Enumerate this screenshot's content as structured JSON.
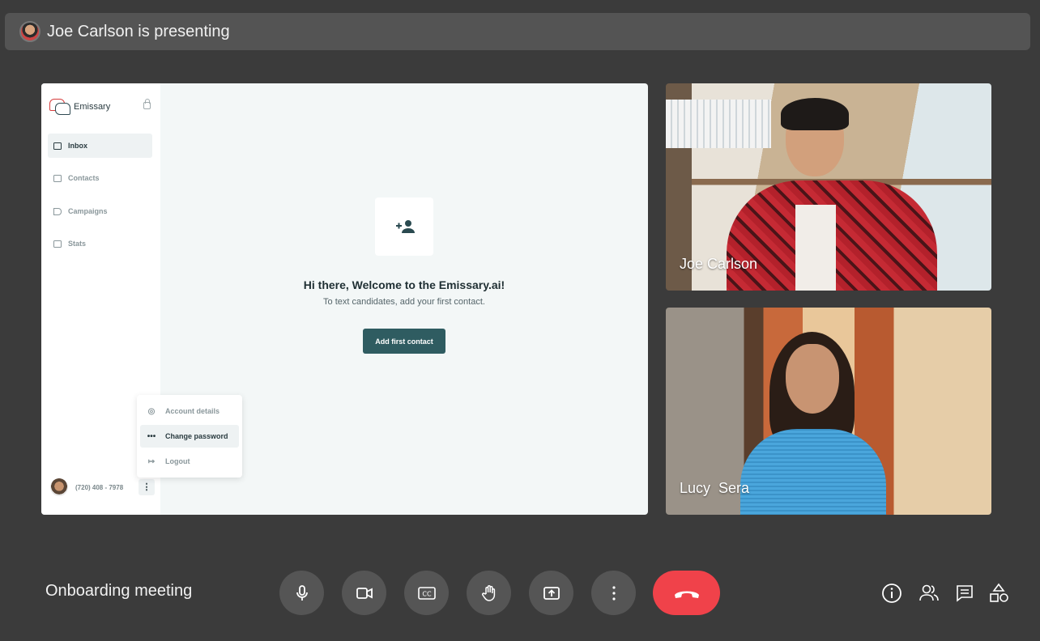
{
  "presenter_bar": {
    "text": "Joe Carlson is presenting"
  },
  "shared_screen": {
    "brand_name": "Emissary",
    "nav": [
      {
        "label": "Inbox",
        "icon": "inbox-icon",
        "active": true
      },
      {
        "label": "Contacts",
        "icon": "contacts-icon",
        "active": false
      },
      {
        "label": "Campaigns",
        "icon": "megaphone-icon",
        "active": false
      },
      {
        "label": "Stats",
        "icon": "stats-icon",
        "active": false
      }
    ],
    "popup_menu": [
      {
        "label": "Account details",
        "icon": "account-icon"
      },
      {
        "label": "Change password",
        "icon": "password-icon",
        "active": true
      },
      {
        "label": "Logout",
        "icon": "logout-icon"
      }
    ],
    "user_phone": "(720) 408 - 7978",
    "welcome_title": "Hi there, Welcome to the Emissary.ai!",
    "welcome_subtitle": "To text candidates, add your first contact.",
    "add_contact_label": "Add first contact",
    "accent_color": "#2f5c61"
  },
  "participants": [
    {
      "name": "Joe Carlson"
    },
    {
      "name": "Lucy  Sera"
    }
  ],
  "meeting": {
    "title": "Onboarding meeting",
    "controls": [
      "microphone-icon",
      "camera-icon",
      "captions-icon",
      "raise-hand-icon",
      "present-screen-icon",
      "more-options-icon"
    ],
    "end_call_color": "#f0424a",
    "right_icons": [
      "info-icon",
      "people-icon",
      "chat-icon",
      "activities-icon"
    ]
  }
}
